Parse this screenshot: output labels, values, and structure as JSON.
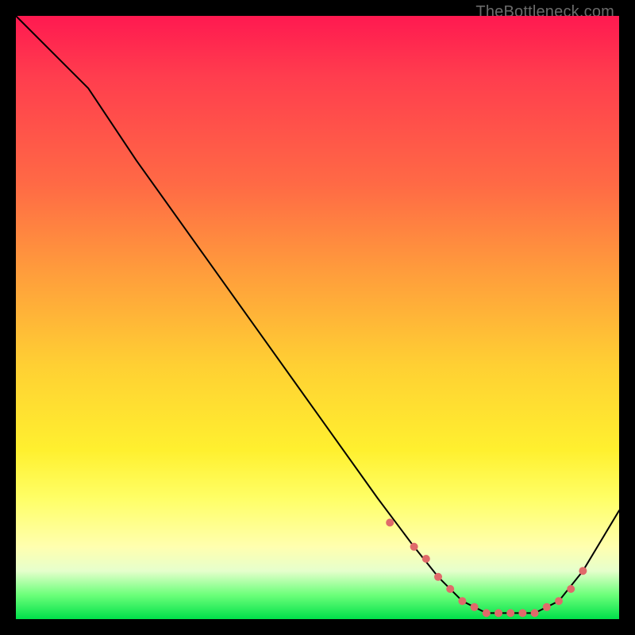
{
  "watermark": "TheBottleneck.com",
  "chart_data": {
    "type": "line",
    "title": "",
    "xlabel": "",
    "ylabel": "",
    "xlim": [
      0,
      100
    ],
    "ylim": [
      0,
      100
    ],
    "grid": false,
    "legend": false,
    "series": [
      {
        "name": "curve",
        "x": [
          0,
          8,
          12,
          20,
          30,
          40,
          50,
          60,
          66,
          70,
          74,
          78,
          82,
          86,
          90,
          94,
          100
        ],
        "y": [
          100,
          92,
          88,
          76,
          62,
          48,
          34,
          20,
          12,
          7,
          3,
          1,
          1,
          1,
          3,
          8,
          18
        ]
      }
    ],
    "markers": {
      "comment": "dots drawn along the low/flat region of the curve",
      "x": [
        62,
        66,
        68,
        70,
        72,
        74,
        76,
        78,
        80,
        82,
        84,
        86,
        88,
        90,
        92,
        94
      ],
      "y": [
        16,
        12,
        10,
        7,
        5,
        3,
        2,
        1,
        1,
        1,
        1,
        1,
        2,
        3,
        5,
        8
      ]
    },
    "colors": {
      "line": "#000000",
      "dot": "#e06a6a",
      "gradient_stops": [
        "#ff1950",
        "#ff6a45",
        "#ffd033",
        "#ffff66",
        "#e6ffcc",
        "#00e04a"
      ]
    }
  }
}
